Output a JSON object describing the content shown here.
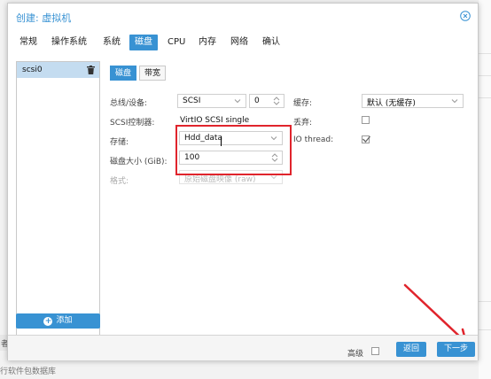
{
  "dialog": {
    "title": "创建: 虚拟机"
  },
  "tabs": [
    "常规",
    "操作系统",
    "系统",
    "磁盘",
    "CPU",
    "内存",
    "网络",
    "确认"
  ],
  "active_tab": "磁盘",
  "disk_list": {
    "items": [
      {
        "label": "scsi0"
      }
    ],
    "add_label": "添加"
  },
  "subtabs": [
    "磁盘",
    "带宽"
  ],
  "form": {
    "bus_label": "总线/设备:",
    "bus_value": "SCSI",
    "device_value": "0",
    "controller_label": "SCSI控制器:",
    "controller_value": "VirtIO SCSI single",
    "storage_label": "存储:",
    "storage_value": "Hdd_data",
    "size_label": "磁盘大小 (GiB):",
    "size_value": "100",
    "format_label": "格式:",
    "format_value": "原始磁盘映像 (raw)",
    "cache_label": "缓存:",
    "cache_value": "默认 (无缓存)",
    "discard_label": "丢弃:",
    "iothread_label": "IO thread:"
  },
  "footer": {
    "advanced_label": "高级",
    "back_label": "返回",
    "next_label": "下一步"
  },
  "background": {
    "bottom_text": "行软件包数据库",
    "edge_text": "者"
  },
  "colors": {
    "accent": "#3892d3",
    "annotation": "#e0242c"
  },
  "checkbox_states": {
    "discard": false,
    "iothread": true,
    "advanced": false
  }
}
